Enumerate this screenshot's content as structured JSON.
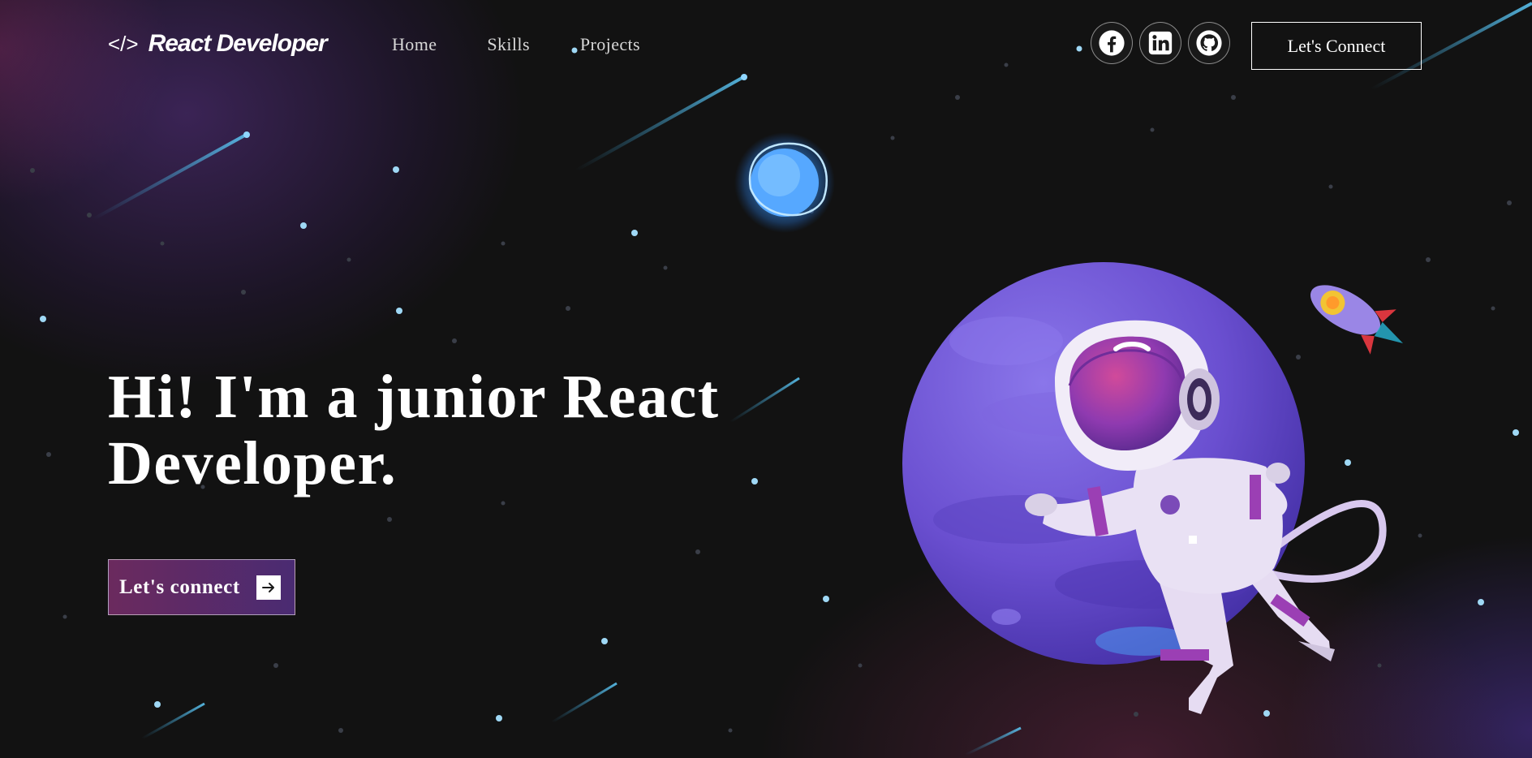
{
  "nav": {
    "logo_symbol": "</>",
    "logo_text": "React Developer",
    "links": [
      {
        "label": "Home"
      },
      {
        "label": "Skills"
      },
      {
        "label": "Projects"
      }
    ],
    "social": [
      {
        "icon": "facebook-icon"
      },
      {
        "icon": "linkedin-icon"
      },
      {
        "icon": "github-icon"
      }
    ],
    "connect_label": "Let's Connect"
  },
  "hero": {
    "headline_line1": "Hi! I'm a junior React",
    "headline_line2": "Developer.",
    "cta_label": "Let's connect"
  },
  "colors": {
    "background": "#121212",
    "planet": "#6a4fd0",
    "cta_start": "#6b2a5e",
    "cta_end": "#4a2b72",
    "star": "#9fd8f5"
  },
  "illustration": {
    "icons": [
      "blue-star-icon",
      "purple-planet-icon",
      "astronaut-icon",
      "rocket-icon"
    ]
  }
}
